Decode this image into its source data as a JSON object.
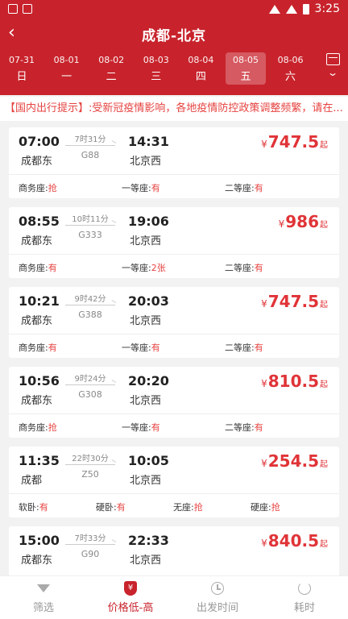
{
  "status_bar": {
    "time": "3:25"
  },
  "header": {
    "back_icon": "back-chevron-icon",
    "title": "成都-北京",
    "dates": [
      {
        "date": "07-31",
        "weekday": "日"
      },
      {
        "date": "08-01",
        "weekday": "一"
      },
      {
        "date": "08-02",
        "weekday": "二"
      },
      {
        "date": "08-03",
        "weekday": "三"
      },
      {
        "date": "08-04",
        "weekday": "四"
      },
      {
        "date": "08-05",
        "weekday": "五",
        "selected": true
      },
      {
        "date": "08-06",
        "weekday": "六"
      }
    ]
  },
  "notice": "【国内出行提示】:受新冠疫情影响，各地疫情防控政策调整频繁，请在...",
  "trains": [
    {
      "dep_time": "07:00",
      "dep_station": "成都东",
      "duration": "7时31分",
      "train_no": "G88",
      "arr_time": "14:31",
      "arr_station": "北京西",
      "price": "747.5",
      "currency": "¥",
      "price_suffix": "起",
      "seats": [
        {
          "name": "商务座:",
          "avail": "抢"
        },
        {
          "name": "一等座:",
          "avail": "有"
        },
        {
          "name": "二等座:",
          "avail": "有"
        }
      ]
    },
    {
      "dep_time": "08:55",
      "dep_station": "成都东",
      "duration": "10时11分",
      "train_no": "G333",
      "arr_time": "19:06",
      "arr_station": "北京西",
      "price": "986",
      "currency": "¥",
      "price_suffix": "起",
      "seats": [
        {
          "name": "商务座:",
          "avail": "有"
        },
        {
          "name": "一等座:",
          "avail": "2张"
        },
        {
          "name": "二等座:",
          "avail": "有"
        }
      ]
    },
    {
      "dep_time": "10:21",
      "dep_station": "成都东",
      "duration": "9时42分",
      "train_no": "G388",
      "arr_time": "20:03",
      "arr_station": "北京西",
      "price": "747.5",
      "currency": "¥",
      "price_suffix": "起",
      "seats": [
        {
          "name": "商务座:",
          "avail": "有"
        },
        {
          "name": "一等座:",
          "avail": "有"
        },
        {
          "name": "二等座:",
          "avail": "有"
        }
      ]
    },
    {
      "dep_time": "10:56",
      "dep_station": "成都东",
      "duration": "9时24分",
      "train_no": "G308",
      "arr_time": "20:20",
      "arr_station": "北京西",
      "price": "810.5",
      "currency": "¥",
      "price_suffix": "起",
      "seats": [
        {
          "name": "商务座:",
          "avail": "抢"
        },
        {
          "name": "一等座:",
          "avail": "有"
        },
        {
          "name": "二等座:",
          "avail": "有"
        }
      ]
    },
    {
      "dep_time": "11:35",
      "dep_station": "成都",
      "duration": "22时30分",
      "train_no": "Z50",
      "arr_time": "10:05",
      "arr_station": "北京西",
      "price": "254.5",
      "currency": "¥",
      "price_suffix": "起",
      "seats": [
        {
          "name": "软卧:",
          "avail": "有"
        },
        {
          "name": "硬卧:",
          "avail": "有"
        },
        {
          "name": "无座:",
          "avail": "抢"
        },
        {
          "name": "硬座:",
          "avail": "抢"
        }
      ]
    },
    {
      "dep_time": "15:00",
      "dep_station": "成都东",
      "duration": "7时33分",
      "train_no": "G90",
      "arr_time": "22:33",
      "arr_station": "北京西",
      "price": "840.5",
      "currency": "¥",
      "price_suffix": "起",
      "seats": []
    }
  ],
  "tabbar": [
    {
      "label": "筛选",
      "icon": "filter-icon"
    },
    {
      "label": "价格低-高",
      "icon": "price-sort-icon",
      "active": true
    },
    {
      "label": "出发时间",
      "icon": "clock-icon"
    },
    {
      "label": "耗时",
      "icon": "timer-icon"
    }
  ]
}
